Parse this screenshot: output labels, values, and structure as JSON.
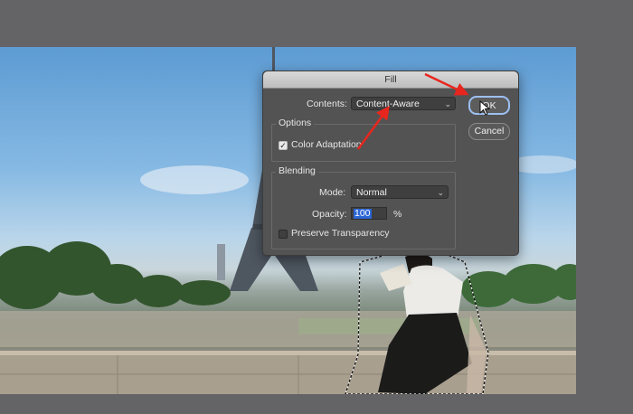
{
  "dialog": {
    "title": "Fill",
    "contents_label": "Contents:",
    "contents_value": "Content-Aware",
    "options_title": "Options",
    "color_adaptation_label": "Color Adaptation",
    "blending_title": "Blending",
    "mode_label": "Mode:",
    "mode_value": "Normal",
    "opacity_label": "Opacity:",
    "opacity_value": "100",
    "opacity_unit": "%",
    "preserve_transparency_label": "Preserve Transparency",
    "ok_label": "OK",
    "cancel_label": "Cancel"
  },
  "icons": {
    "chevron": "chevron-down-icon",
    "check": "checkmark-icon",
    "cursor": "pointer-cursor-icon",
    "arrow": "red-arrow-annotation"
  },
  "colors": {
    "annotation_red": "#e8261e",
    "ok_focus_ring": "#9cc0f2",
    "selection_highlight": "#2d67d6"
  }
}
